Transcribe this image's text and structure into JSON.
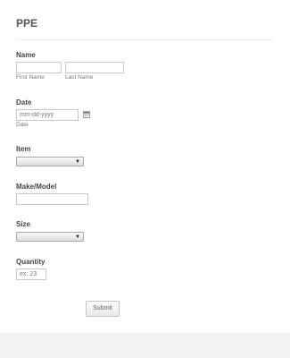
{
  "form": {
    "title": "PPE",
    "fields": {
      "name": {
        "label": "Name",
        "first_sublabel": "First Name",
        "last_sublabel": "Last Name",
        "first_value": "",
        "last_value": ""
      },
      "date": {
        "label": "Date",
        "placeholder": "mm-dd-yyyy",
        "sublabel": "Date",
        "icon": "calendar-icon"
      },
      "item": {
        "label": "Item",
        "selected": ""
      },
      "make_model": {
        "label": "Make/Model",
        "value": ""
      },
      "size": {
        "label": "Size",
        "selected": ""
      },
      "quantity": {
        "label": "Quantity",
        "placeholder": "ex: 23"
      }
    },
    "submit_label": "Submit"
  },
  "colors": {
    "background": "#ffffff",
    "footer_band": "#f2f2f2",
    "text": "#555555",
    "input_border": "#c8c8c8"
  }
}
